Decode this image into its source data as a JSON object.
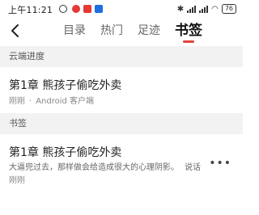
{
  "statusbar": {
    "time": "上午11:21",
    "battery": "76"
  },
  "header": {
    "tabs": [
      {
        "label": "目录",
        "active": false
      },
      {
        "label": "热门",
        "active": false
      },
      {
        "label": "足迹",
        "active": false
      },
      {
        "label": "书签",
        "active": true
      }
    ]
  },
  "cloud_progress": {
    "section_title": "云端进度",
    "title": "第1章 熊孩子偷吃外卖",
    "time": "刚刚",
    "device": "Android 客户端"
  },
  "bookmarks": {
    "section_title": "书签",
    "items": [
      {
        "title": "第1章 熊孩子偷吃外卖",
        "excerpt": "大逼兜过去，那样做会给造成很大的心理阴影。",
        "more_label": "说话",
        "time": "刚刚"
      }
    ]
  },
  "colors": {
    "accent": "#e0463a",
    "section_bg": "#f2f2f2"
  },
  "icons": {
    "back": "chevron-left-icon",
    "more": "more-horizontal-icon"
  }
}
